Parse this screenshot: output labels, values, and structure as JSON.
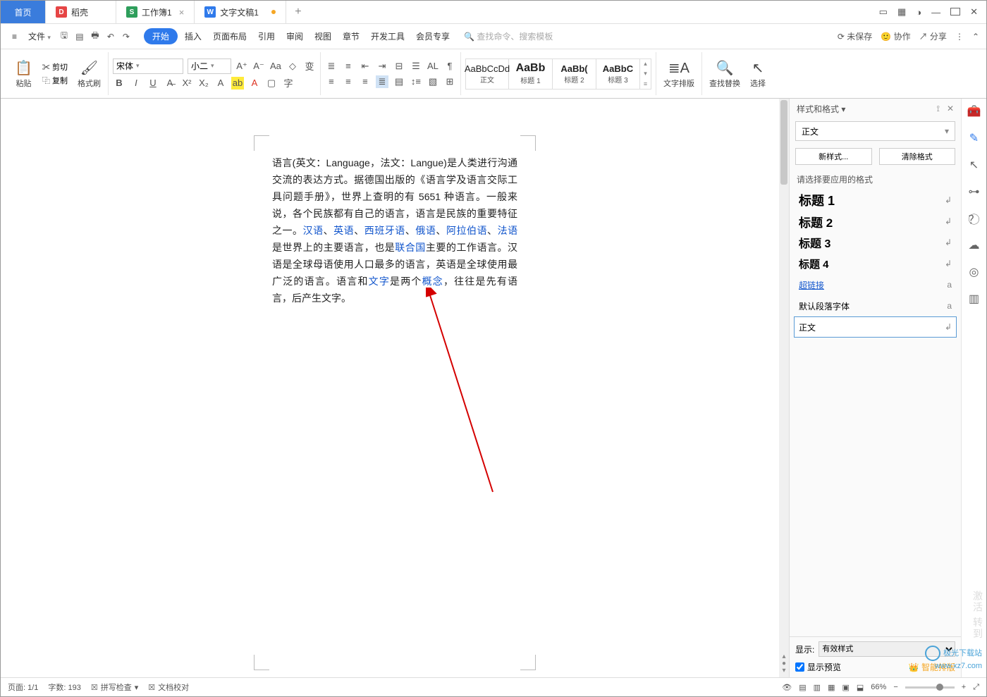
{
  "tabs": {
    "home": "首页",
    "t1": "稻壳",
    "t2": "工作簿1",
    "t3": "文字文稿1"
  },
  "menu": {
    "file": "文件",
    "start": "开始",
    "insert": "插入",
    "layout": "页面布局",
    "ref": "引用",
    "review": "审阅",
    "view": "视图",
    "chapter": "章节",
    "dev": "开发工具",
    "member": "会员专享",
    "search": "查找命令、搜索模板",
    "unsaved": "未保存",
    "coop": "协作",
    "share": "分享"
  },
  "ribbon": {
    "cut": "剪切",
    "copy": "复制",
    "paste": "粘贴",
    "brush": "格式刷",
    "fontname": "宋体",
    "fontsize": "小二",
    "style_preview": "AaBbCcDd",
    "style_preview_bold": "AaBb",
    "style_preview_c": "AaBb(",
    "style_preview_d": "AaBbC",
    "s1": "正文",
    "s2": "标题 1",
    "s3": "标题 2",
    "s4": "标题 3",
    "typeset": "文字排版",
    "findrep": "查找替换",
    "select": "选择"
  },
  "doc": {
    "p1a": "语言(英文：Language，法文：Langue)是人类进行沟通交流的表达方式。据德国出版的《语言学及语言交际工具问题手册》，世界上查明的有 5651 种语言。一般来说，各个民族都有自己的语言，语言是民族的重要特征之一。",
    "l1": "汉语",
    "l2": "英语",
    "l3": "西班牙语",
    "l4": "俄语",
    "l5": "阿拉伯语",
    "l6": "法语",
    "p1b": "是世界上的主要语言，也是",
    "l7": "联合国",
    "p1c": "主要的工作语言。汉语是全球母语使用人口最多的语言，英语是全球使用最广泛的语言。语言和",
    "l8": "文字",
    "p1d": "是两个",
    "l9": "概念",
    "p1e": "，往往是先有语言，后产生文字。"
  },
  "panel": {
    "title": "样式和格式",
    "current": "正文",
    "newstyle": "新样式...",
    "clear": "清除格式",
    "prompt": "请选择要应用的格式",
    "h1": "标题 1",
    "h2": "标题 2",
    "h3": "标题 3",
    "h4": "标题 4",
    "link": "超链接",
    "default": "默认段落字体",
    "body": "正文",
    "showlbl": "显示:",
    "showval": "有效样式",
    "preview": "显示预览",
    "smart": "智能排版"
  },
  "status": {
    "page": "页面: 1/1",
    "words": "字数: 193",
    "spell": "拼写检查",
    "proof": "文档校对",
    "zoom": "66%"
  },
  "watermark": {
    "l1": "极光下载站",
    "l2": "www.xz7.com"
  },
  "activate": "激活\n转到"
}
